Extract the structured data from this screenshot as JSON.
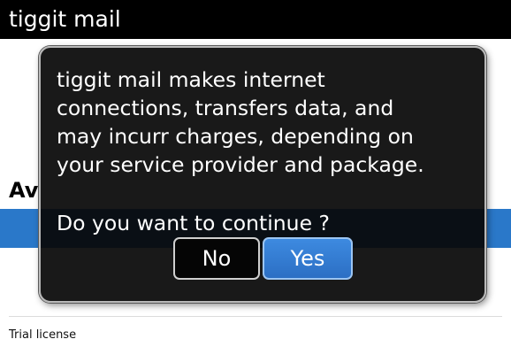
{
  "app": {
    "title": "tiggit mail"
  },
  "background": {
    "heading_fragment": "Av"
  },
  "dialog": {
    "message": "tiggit mail makes internet\nconnections, transfers data, and\nmay incurr charges, depending on\nyour service provider and package.",
    "prompt": "Do you want to continue ?",
    "no_label": "No",
    "yes_label": "Yes"
  },
  "footer": {
    "license_text": "Trial license"
  },
  "colors": {
    "titlebar_bg": "#000000",
    "accent_blue": "#2a78c9",
    "dialog_bg": "#080808"
  }
}
